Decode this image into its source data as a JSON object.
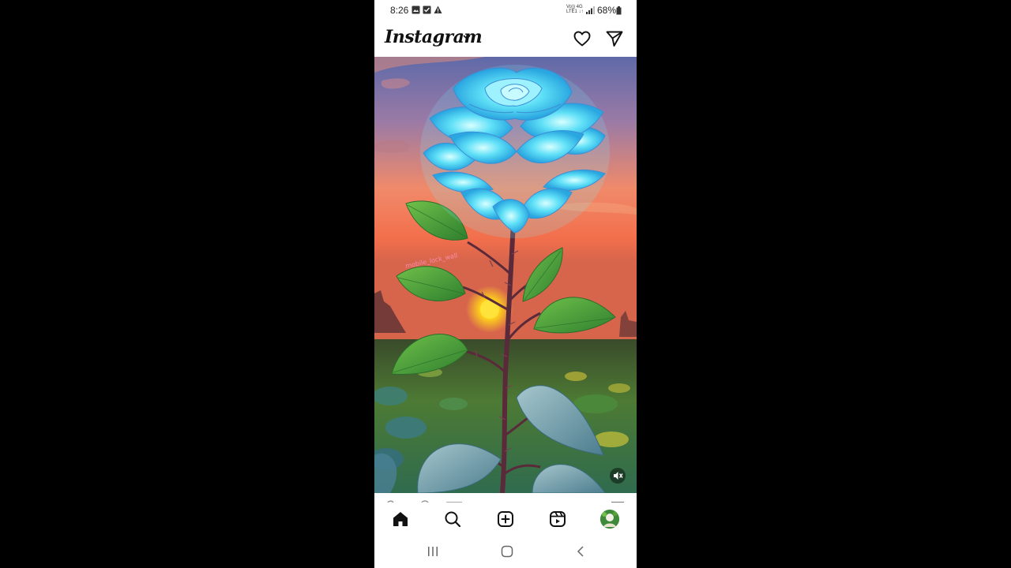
{
  "status_bar": {
    "time": "8:26",
    "network_top": "Vo)) 4G",
    "network_bottom": "LTE1 ↓↑",
    "battery": "68%",
    "icons": [
      "gallery-icon",
      "check-square-icon",
      "warning-icon",
      "signal-icon",
      "battery-icon"
    ]
  },
  "header": {
    "logo": "Instagram",
    "icons": [
      "chevron-down-icon",
      "heart-icon",
      "direct-message-icon"
    ]
  },
  "reel": {
    "subject": "blue glowing rose with thorny stem and green leaves at sunset over a field",
    "watermark": "mobile_lock_wall",
    "icons": [
      "mute-icon"
    ]
  },
  "bottom_nav": {
    "items": [
      "home-icon",
      "search-icon",
      "create-icon",
      "reels-icon",
      "profile-avatar"
    ],
    "active": "home-icon"
  },
  "system_nav": {
    "items": [
      "recents-icon",
      "home-circle-icon",
      "back-icon"
    ]
  },
  "colors": {
    "accent_rose": "#4fd8f5",
    "sky_top": "#6b6fa8",
    "sky_mid": "#f08a6a",
    "sun": "#ffd21a",
    "leaf": "#3f9a3a",
    "stem": "#5b2a3a"
  }
}
